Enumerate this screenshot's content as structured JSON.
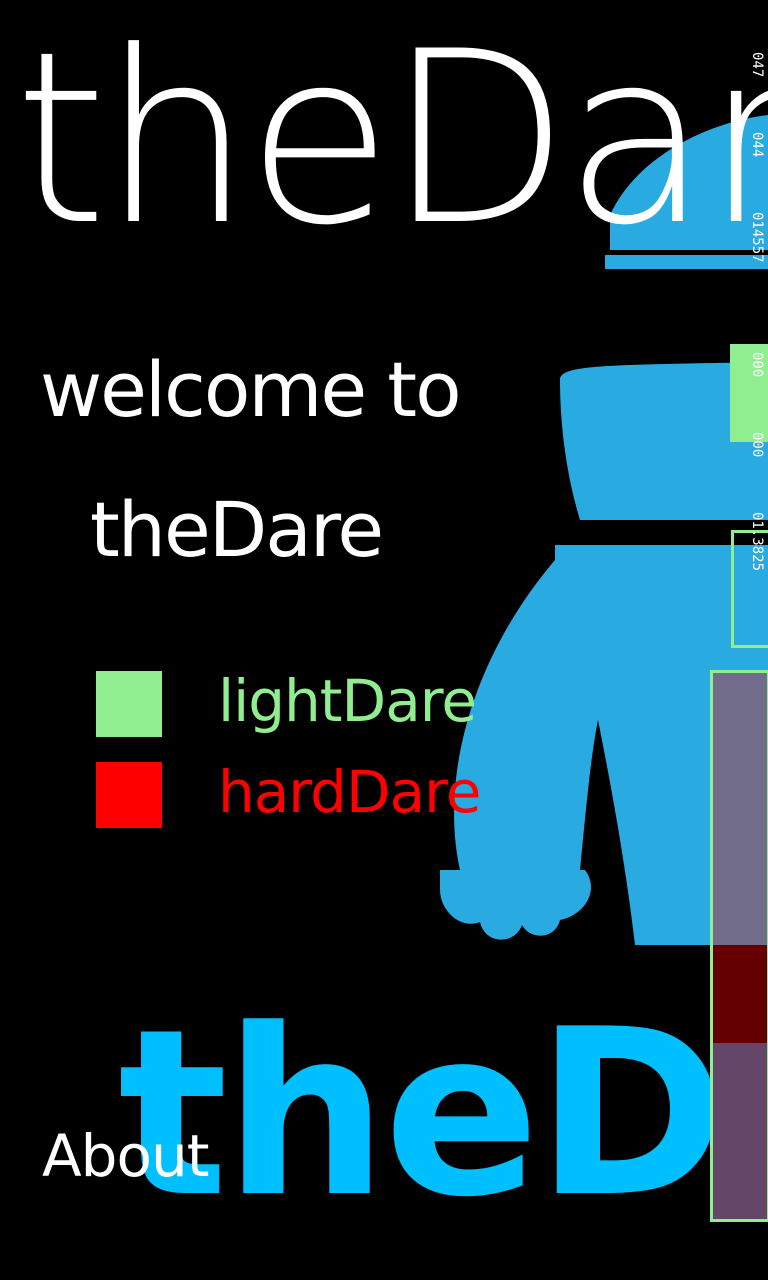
{
  "app": {
    "title": "theDare"
  },
  "welcome": {
    "line1": "welcome to",
    "line2": "theDare"
  },
  "menu": {
    "items": [
      {
        "label": "lightDare",
        "color": "#90ee90"
      },
      {
        "label": "hardDare",
        "color": "#ff0000"
      }
    ]
  },
  "footer": {
    "about_label": "About"
  },
  "logo": {
    "text": "theDare",
    "color": "#00bfff"
  },
  "mascot": {
    "icon": "blue-mascot-figure",
    "color": "#29abe2"
  },
  "debug_overlay": {
    "values": [
      "047",
      "044",
      "014557",
      "000",
      "000",
      "01.3825"
    ]
  }
}
